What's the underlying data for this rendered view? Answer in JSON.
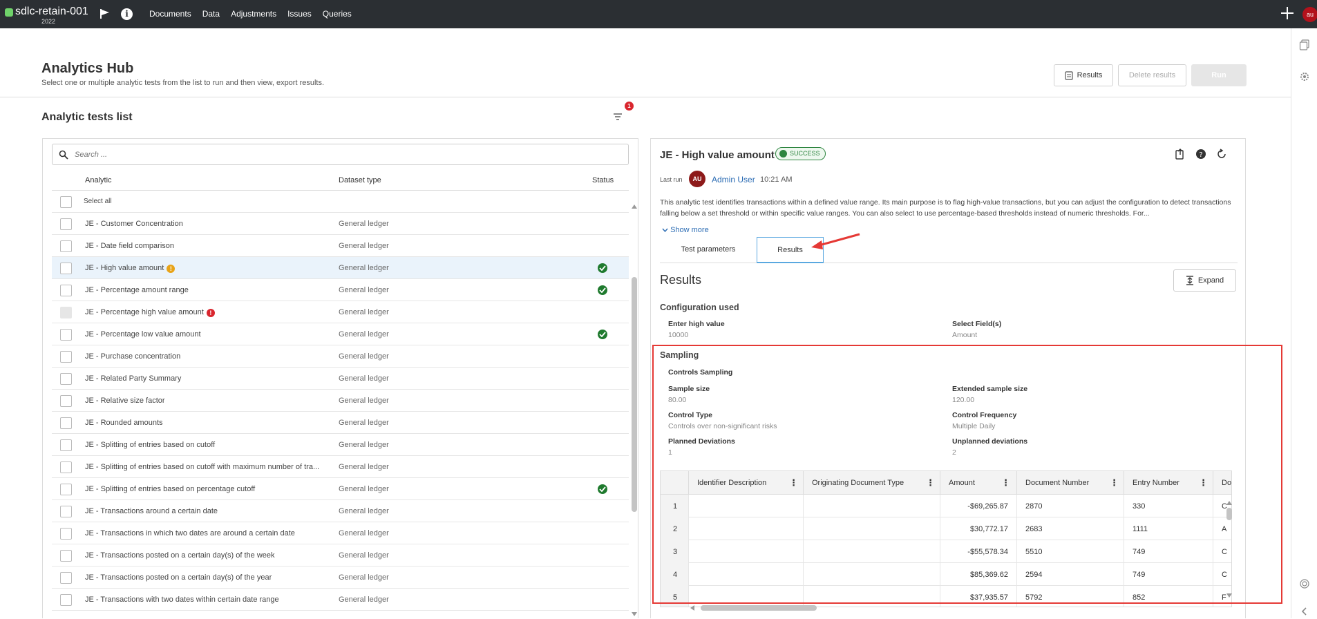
{
  "topbar": {
    "app_name": "sdlc-retain-001",
    "year": "2022",
    "nav": [
      "Documents",
      "Data",
      "Adjustments",
      "Issues",
      "Queries"
    ],
    "user_initials": "au"
  },
  "header": {
    "title": "Analytics Hub",
    "subtitle": "Select one or multiple analytic tests from the list to run and then view, export results.",
    "results_button": "Results",
    "delete_button": "Delete results",
    "run_button": "Run"
  },
  "list_panel": {
    "title": "Analytic tests list",
    "filter_count": "1",
    "search_placeholder": "Search ...",
    "columns": {
      "analytic": "Analytic",
      "dataset": "Dataset type",
      "status": "Status"
    },
    "select_all": "Select all",
    "rows": [
      {
        "name": "JE - Customer Concentration",
        "type": "General ledger",
        "warn": "",
        "ok": false
      },
      {
        "name": "JE - Date field comparison",
        "type": "General ledger",
        "warn": "",
        "ok": false
      },
      {
        "name": "JE - High value amount",
        "type": "General ledger",
        "warn": "orange",
        "ok": true,
        "selected": true
      },
      {
        "name": "JE - Percentage amount range",
        "type": "General ledger",
        "warn": "",
        "ok": true
      },
      {
        "name": "JE - Percentage high value amount",
        "type": "General ledger",
        "warn": "red",
        "ok": false,
        "disabled": true
      },
      {
        "name": "JE - Percentage low value amount",
        "type": "General ledger",
        "warn": "",
        "ok": true
      },
      {
        "name": "JE - Purchase concentration",
        "type": "General ledger",
        "warn": "",
        "ok": false
      },
      {
        "name": "JE - Related Party Summary",
        "type": "General ledger",
        "warn": "",
        "ok": false
      },
      {
        "name": "JE - Relative size factor",
        "type": "General ledger",
        "warn": "",
        "ok": false
      },
      {
        "name": "JE - Rounded amounts",
        "type": "General ledger",
        "warn": "",
        "ok": false
      },
      {
        "name": "JE - Splitting of entries based on cutoff",
        "type": "General ledger",
        "warn": "",
        "ok": false
      },
      {
        "name": "JE - Splitting of entries based on cutoff with maximum number of tra...",
        "type": "General ledger",
        "warn": "",
        "ok": false
      },
      {
        "name": "JE - Splitting of entries based on percentage cutoff",
        "type": "General ledger",
        "warn": "",
        "ok": true
      },
      {
        "name": "JE - Transactions around a certain date",
        "type": "General ledger",
        "warn": "",
        "ok": false
      },
      {
        "name": "JE - Transactions in which two dates are around a certain date",
        "type": "General ledger",
        "warn": "",
        "ok": false
      },
      {
        "name": "JE - Transactions posted on a certain day(s) of the week",
        "type": "General ledger",
        "warn": "",
        "ok": false
      },
      {
        "name": "JE - Transactions posted on a certain day(s) of the year",
        "type": "General ledger",
        "warn": "",
        "ok": false
      },
      {
        "name": "JE - Transactions with two dates within certain date range",
        "type": "General ledger",
        "warn": "",
        "ok": false
      }
    ]
  },
  "detail": {
    "title": "JE - High value amount",
    "status": "SUCCESS",
    "last_run_label": "Last run",
    "user_initials": "AU",
    "user_name": "Admin User",
    "run_time": "10:21 AM",
    "description": "This analytic test identifies transactions within a defined value range. Its main purpose is to flag high-value transactions, but you can adjust the configuration to detect transactions falling below a set threshold or within specific value ranges. You can also select to use percentage-based thresholds instead of numeric thresholds. For...",
    "show_more": "Show more",
    "tabs": [
      "Test parameters",
      "Results"
    ],
    "active_tab": "Results",
    "results_title": "Results",
    "expand": "Expand",
    "config_title": "Configuration used",
    "config": {
      "high_label": "Enter high value",
      "high_value": "10000",
      "fields_label": "Select Field(s)",
      "fields_value": "Amount"
    },
    "sampling_title": "Sampling",
    "controls_title": "Controls Sampling",
    "sampling": {
      "sample_size_label": "Sample size",
      "sample_size": "80.00",
      "ext_label": "Extended sample size",
      "ext_value": "120.00",
      "ctype_label": "Control Type",
      "ctype_value": "Controls over non-significant risks",
      "cfreq_label": "Control Frequency",
      "cfreq_value": "Multiple Daily",
      "planned_label": "Planned Deviations",
      "planned_value": "1",
      "unplanned_label": "Unplanned deviations",
      "unplanned_value": "2"
    },
    "grid": {
      "columns": [
        "Identifier Description",
        "Originating Document Type",
        "Amount",
        "Document Number",
        "Entry Number",
        "Doc"
      ],
      "rows": [
        {
          "n": "1",
          "amount": "-$69,265.87",
          "doc": "2870",
          "entry": "330",
          "tail": "C"
        },
        {
          "n": "2",
          "amount": "$30,772.17",
          "doc": "2683",
          "entry": "1111",
          "tail": "A"
        },
        {
          "n": "3",
          "amount": "-$55,578.34",
          "doc": "5510",
          "entry": "749",
          "tail": "C"
        },
        {
          "n": "4",
          "amount": "$85,369.62",
          "doc": "2594",
          "entry": "749",
          "tail": "C"
        },
        {
          "n": "5",
          "amount": "$37,935.57",
          "doc": "5792",
          "entry": "852",
          "tail": "F"
        }
      ]
    }
  }
}
